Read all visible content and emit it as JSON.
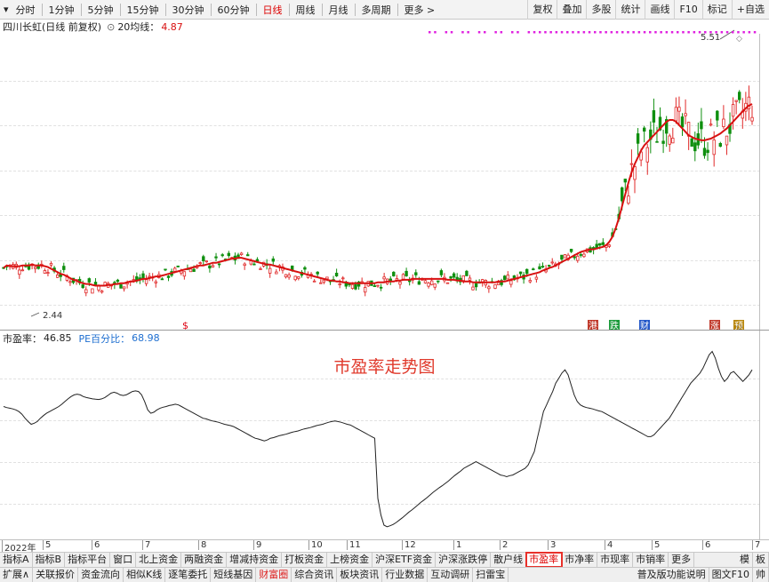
{
  "toolbar": {
    "periods": [
      "分时",
      "1分钟",
      "5分钟",
      "15分钟",
      "30分钟",
      "60分钟",
      "日线",
      "周线",
      "月线",
      "多周期",
      "更多 >"
    ],
    "active_period": "日线",
    "tools": [
      "复权",
      "叠加",
      "多股",
      "统计",
      "画线",
      "F10",
      "标记",
      "+自选"
    ]
  },
  "panel1": {
    "stock_title": "四川长虹(日线 前复权)",
    "ma_label": "20均线：",
    "ma_value": "4.87",
    "high_label": "5.51",
    "low_label": "2.44",
    "markers": [
      "$",
      "港",
      "跌",
      "财",
      "涨",
      "预"
    ]
  },
  "panel2": {
    "indicator_label": "市盈率：",
    "indicator_value": "46.85",
    "pe_label": "PE百分比：",
    "pe_value": "68.98",
    "annotation": "市盈率走势图"
  },
  "xaxis": [
    "2022年",
    "5",
    "6",
    "7",
    "8",
    "9",
    "10",
    "11",
    "12",
    "1",
    "2",
    "3",
    "4",
    "5",
    "6",
    "7"
  ],
  "tabs_row1": [
    {
      "label": "指标A",
      "state": ""
    },
    {
      "label": "指标B",
      "state": ""
    },
    {
      "label": "指标平台",
      "state": ""
    },
    {
      "label": "窗口",
      "state": ""
    },
    {
      "label": "北上资金",
      "state": ""
    },
    {
      "label": "两融资金",
      "state": ""
    },
    {
      "label": "增减持资金",
      "state": ""
    },
    {
      "label": "打板资金",
      "state": ""
    },
    {
      "label": "上榜资金",
      "state": ""
    },
    {
      "label": "沪深ETF资金",
      "state": ""
    },
    {
      "label": "沪深涨跌停",
      "state": ""
    },
    {
      "label": "散户线",
      "state": ""
    },
    {
      "label": "市盈率",
      "state": "sel"
    },
    {
      "label": "市净率",
      "state": ""
    },
    {
      "label": "市现率",
      "state": ""
    },
    {
      "label": "市销率",
      "state": ""
    },
    {
      "label": "更多",
      "state": ""
    }
  ],
  "tabs_row1_right": [
    "模",
    "板"
  ],
  "tabs_row2": [
    {
      "label": "扩展∧",
      "state": ""
    },
    {
      "label": "关联报价",
      "state": ""
    },
    {
      "label": "资金流向",
      "state": ""
    },
    {
      "label": "相似K线",
      "state": ""
    },
    {
      "label": "逐笔委托",
      "state": ""
    },
    {
      "label": "短线基因",
      "state": ""
    },
    {
      "label": "财富圈",
      "state": "hl"
    },
    {
      "label": "综合资讯",
      "state": ""
    },
    {
      "label": "板块资讯",
      "state": ""
    },
    {
      "label": "行业数据",
      "state": ""
    },
    {
      "label": "互动调研",
      "state": ""
    },
    {
      "label": "扫雷宝",
      "state": ""
    }
  ],
  "tabs_row2_right": [
    "普及版功能说明",
    "图文F10",
    "帅"
  ],
  "colors": {
    "up": "#e02828",
    "down": "#0f8f0f",
    "ma": "#d81010",
    "pe": "#222222",
    "accent": "#e8302a"
  },
  "chart_data": [
    {
      "type": "candlestick",
      "ylim": [
        2.2,
        5.7
      ],
      "series": [
        {
          "name": "20均线",
          "values": [
            2.93,
            2.96,
            2.95,
            2.95,
            2.95,
            2.95,
            2.96,
            2.96,
            2.96,
            2.97,
            2.96,
            2.96,
            2.96,
            2.95,
            2.94,
            2.92,
            2.9,
            2.88,
            2.86,
            2.85,
            2.83,
            2.81,
            2.79,
            2.78,
            2.76,
            2.75,
            2.74,
            2.74,
            2.73,
            2.72,
            2.72,
            2.72,
            2.72,
            2.73,
            2.73,
            2.74,
            2.74,
            2.75,
            2.75,
            2.76,
            2.77,
            2.77,
            2.78,
            2.79,
            2.8,
            2.8,
            2.81,
            2.82,
            2.83,
            2.83,
            2.84,
            2.85,
            2.86,
            2.87,
            2.88,
            2.89,
            2.9,
            2.91,
            2.92,
            2.93,
            2.94,
            2.95,
            2.96,
            2.96,
            2.97,
            2.98,
            2.99,
            2.99,
            3.0,
            3.01,
            3.02,
            3.03,
            3.04,
            3.04,
            3.05,
            3.05,
            3.04,
            3.03,
            3.02,
            3.01,
            3.0,
            2.99,
            2.98,
            2.97,
            2.97,
            2.96,
            2.95,
            2.94,
            2.93,
            2.92,
            2.91,
            2.9,
            2.89,
            2.88,
            2.87,
            2.86,
            2.85,
            2.84,
            2.83,
            2.82,
            2.81,
            2.8,
            2.79,
            2.78,
            2.78,
            2.77,
            2.77,
            2.76,
            2.76,
            2.75,
            2.75,
            2.75,
            2.75,
            2.75,
            2.75,
            2.75,
            2.75,
            2.75,
            2.76,
            2.76,
            2.76,
            2.77,
            2.77,
            2.77,
            2.78,
            2.78,
            2.79,
            2.79,
            2.79,
            2.8,
            2.8,
            2.8,
            2.8,
            2.8,
            2.8,
            2.8,
            2.8,
            2.8,
            2.8,
            2.8,
            2.79,
            2.79,
            2.79,
            2.78,
            2.78,
            2.77,
            2.77,
            2.77,
            2.76,
            2.76,
            2.76,
            2.76,
            2.76,
            2.76,
            2.76,
            2.76,
            2.77,
            2.77,
            2.77,
            2.78,
            2.79,
            2.8,
            2.81,
            2.82,
            2.83,
            2.84,
            2.85,
            2.86,
            2.87,
            2.88,
            2.9,
            2.91,
            2.93,
            2.94,
            2.96,
            2.98,
            3.0,
            3.02,
            3.04,
            3.06,
            3.08,
            3.1,
            3.12,
            3.13,
            3.14,
            3.15,
            3.15,
            3.16,
            3.17,
            3.18,
            3.2,
            3.24,
            3.3,
            3.4,
            3.52,
            3.66,
            3.8,
            3.94,
            4.06,
            4.16,
            4.24,
            4.32,
            4.38,
            4.42,
            4.46,
            4.5,
            4.54,
            4.58,
            4.62,
            4.66,
            4.68,
            4.68,
            4.66,
            4.62,
            4.58,
            4.54,
            4.5,
            4.48,
            4.46,
            4.45,
            4.44,
            4.44,
            4.45,
            4.46,
            4.48,
            4.5,
            4.52,
            4.55,
            4.58,
            4.62,
            4.66,
            4.7,
            4.74,
            4.78,
            4.82,
            4.85,
            4.87
          ]
        }
      ],
      "annotations": [
        "5.51",
        "2.44"
      ]
    },
    {
      "type": "line",
      "series": [
        {
          "name": "市盈率",
          "values": [
            47.5,
            47.2,
            47.0,
            46.8,
            46.5,
            46.0,
            45.2,
            44.0,
            43.0,
            42.2,
            42.5,
            43.0,
            44.0,
            44.8,
            45.5,
            46.0,
            46.5,
            47.0,
            47.5,
            48.2,
            49.0,
            49.8,
            50.5,
            51.0,
            51.2,
            51.0,
            50.5,
            50.2,
            50.0,
            49.8,
            49.7,
            49.6,
            49.8,
            50.2,
            50.8,
            51.5,
            51.8,
            51.5,
            51.0,
            50.8,
            51.0,
            51.5,
            52.0,
            52.2,
            52.0,
            51.0,
            49.0,
            46.5,
            45.5,
            45.8,
            46.5,
            47.0,
            47.3,
            47.5,
            47.8,
            48.0,
            48.2,
            48.0,
            47.5,
            47.0,
            46.5,
            46.0,
            45.5,
            45.0,
            44.5,
            44.0,
            43.8,
            43.5,
            43.2,
            43.0,
            42.8,
            42.5,
            42.2,
            42.0,
            41.8,
            41.5,
            41.0,
            40.5,
            40.0,
            39.5,
            39.0,
            38.5,
            38.0,
            37.8,
            37.5,
            37.2,
            37.5,
            38.0,
            38.2,
            38.5,
            38.8,
            39.0,
            39.2,
            39.5,
            39.8,
            40.0,
            40.2,
            40.5,
            40.8,
            41.0,
            41.2,
            41.5,
            41.8,
            42.0,
            42.2,
            42.5,
            42.8,
            43.0,
            43.2,
            43.0,
            42.8,
            42.5,
            42.2,
            42.0,
            41.5,
            41.0,
            40.5,
            40.0,
            39.5,
            39.0,
            38.5,
            38.0,
            20.0,
            15.0,
            12.0,
            11.5,
            11.8,
            12.2,
            12.8,
            13.5,
            14.2,
            15.0,
            15.8,
            16.5,
            17.2,
            18.0,
            18.8,
            19.5,
            20.2,
            21.0,
            21.8,
            22.5,
            23.2,
            23.8,
            24.5,
            25.2,
            26.0,
            26.8,
            27.5,
            28.2,
            29.0,
            29.5,
            30.0,
            30.5,
            31.0,
            30.5,
            30.0,
            29.5,
            29.0,
            28.5,
            28.0,
            27.5,
            27.0,
            26.8,
            26.5,
            26.8,
            27.0,
            27.5,
            28.0,
            28.5,
            29.0,
            30.0,
            32.0,
            34.0,
            38.0,
            42.0,
            46.0,
            48.0,
            50.0,
            52.0,
            54.5,
            56.0,
            57.5,
            58.5,
            57.0,
            54.0,
            51.0,
            49.0,
            48.0,
            47.5,
            47.2,
            47.0,
            46.8,
            46.5,
            46.2,
            46.0,
            45.5,
            45.0,
            44.5,
            44.0,
            43.5,
            43.0,
            42.5,
            42.0,
            41.5,
            41.0,
            40.5,
            40.0,
            39.5,
            39.0,
            38.5,
            38.5,
            39.0,
            40.0,
            41.0,
            42.0,
            43.0,
            44.0,
            45.5,
            47.0,
            48.5,
            50.0,
            51.5,
            53.0,
            54.5,
            55.5,
            56.5,
            57.5,
            59.0,
            61.0,
            63.0,
            64.0,
            62.0,
            59.0,
            56.5,
            55.0,
            56.0,
            57.5,
            58.0,
            57.0,
            56.0,
            55.0,
            56.0,
            57.0,
            58.5
          ]
        }
      ]
    }
  ]
}
